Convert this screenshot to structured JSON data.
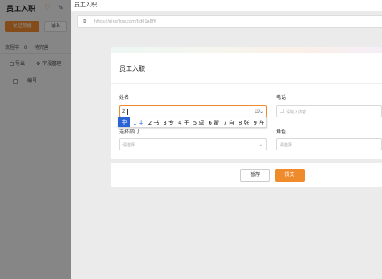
{
  "app": {
    "title": "员工入职",
    "heart_icon": "♡",
    "wrench_icon": "✎",
    "start_button": "发起数据",
    "import_button": "导入",
    "tabs": [
      "流程中 · 0",
      "待完善"
    ],
    "tools": {
      "export": "导出",
      "field_manage": "字段管理"
    },
    "row": {
      "column": "编号"
    }
  },
  "drawer": {
    "title": "员工入职",
    "url_icon": "⧉",
    "url": "https://qingflow.com/f/d01a8fff"
  },
  "form": {
    "title": "员工入职",
    "name_label": "姓名",
    "name_value": "z",
    "name_icon": "☺⌄",
    "phone_label": "电话",
    "phone_icon": "☐",
    "phone_placeholder": "请输入内容",
    "dept_label": "选择部门",
    "dept_placeholder": "请选择",
    "role_label": "角色",
    "role_placeholder": "请选择",
    "chevron": "⌄"
  },
  "ime": {
    "mode": "中",
    "candidates": [
      "1 中",
      "2 书",
      "3 专",
      "4 子",
      "5 卓",
      "6 翟",
      "7 自",
      "8 张",
      "9 在"
    ],
    "more": "⌄"
  },
  "footer": {
    "save_label": "暂存",
    "submit_label": "提交"
  },
  "colors": {
    "accent": "#f08b2c",
    "ime_blue": "#2a63d4"
  }
}
